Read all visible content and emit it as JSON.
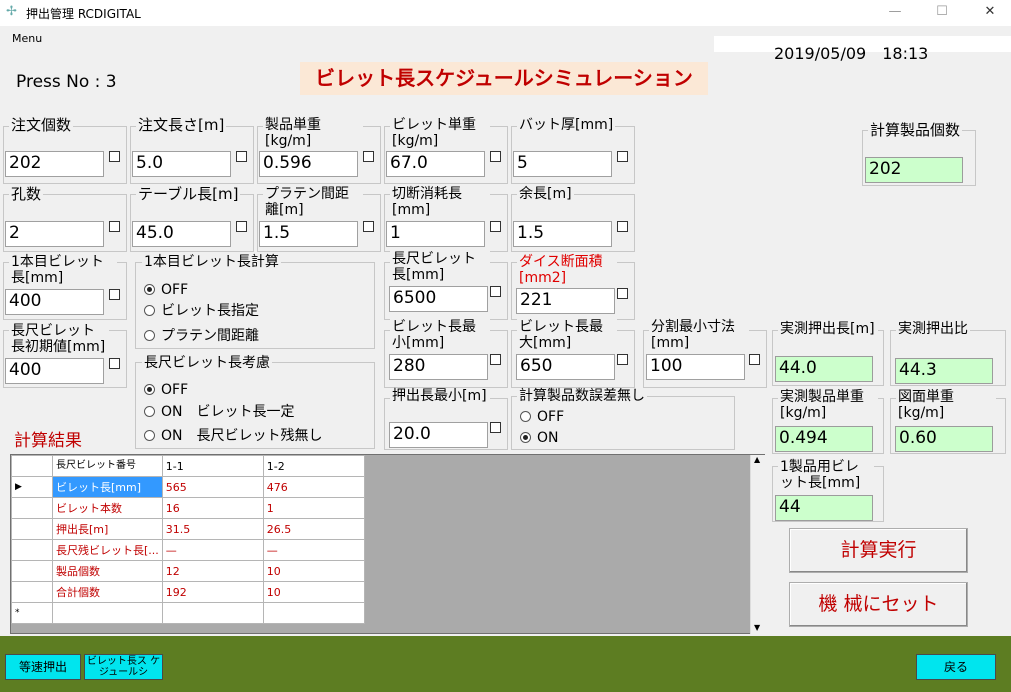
{
  "window": {
    "app_icon": "snowflake-icon",
    "title": "押出管理 RCDIGITAL",
    "minimize": "—",
    "maximize": "☐",
    "close": "✕"
  },
  "menu": {
    "label": "Menu"
  },
  "datetime": "2019/05/09　18:13",
  "press_no": "Press No : 3",
  "banner": "ビレット長スケジュールシミュレーション",
  "fields": {
    "order_count": {
      "label": "注文個数",
      "value": "202"
    },
    "order_length": {
      "label": "注文長さ[m]",
      "value": "5.0"
    },
    "product_unit_weight": {
      "label": "製品単重[kg/m]",
      "value": "0.596"
    },
    "billet_unit_weight": {
      "label": "ビレット単重[kg/m]",
      "value": "67.0"
    },
    "butt_thickness": {
      "label": "バット厚[mm]",
      "value": "5"
    },
    "holes": {
      "label": "孔数",
      "value": "2"
    },
    "table_length": {
      "label": "テーブル長[m]",
      "value": "45.0"
    },
    "platen_distance": {
      "label": "プラテン間距離[m]",
      "value": "1.5"
    },
    "cut_loss": {
      "label": "切断消耗長[mm]",
      "value": "1"
    },
    "remainder": {
      "label": "余長[m]",
      "value": "1.5"
    },
    "first_billet_length": {
      "label": "1本目ビレット長[mm]",
      "value": "400"
    },
    "long_billet_length": {
      "label": "長尺ビレット長[mm]",
      "value": "6500"
    },
    "die_area": {
      "label": "ダイス断面積[mm2]",
      "value": "221"
    },
    "long_billet_initial": {
      "label": "長尺ビレット長初期値[mm]",
      "value": "400"
    },
    "billet_min": {
      "label": "ビレット長最小[mm]",
      "value": "280"
    },
    "billet_max": {
      "label": "ビレット長最大[mm]",
      "value": "650"
    },
    "split_min": {
      "label": "分割最小寸法[mm]",
      "value": "100"
    },
    "extrusion_min": {
      "label": "押出長最小[m]",
      "value": "20.0"
    }
  },
  "first_billet_calc": {
    "title": "1本目ビレット長計算",
    "options": [
      "OFF",
      "ビレット長指定",
      "プラテン間距離"
    ],
    "selected": 0
  },
  "long_billet_consider": {
    "title": "長尺ビレット長考慮",
    "options": [
      "OFF",
      "ON　ビレット長一定",
      "ON　長尺ビレット残無し"
    ],
    "selected": 0
  },
  "calc_error_none": {
    "title": "計算製品数誤差無し",
    "options": [
      "OFF",
      "ON"
    ],
    "selected": 1
  },
  "results_side": {
    "calc_product_count": {
      "label": "計算製品個数",
      "value": "202"
    },
    "measured_length": {
      "label": "実測押出長[m]",
      "value": "44.0"
    },
    "measured_ratio": {
      "label": "実測押出比",
      "value": "44.3"
    },
    "measured_unit_weight": {
      "label": "実測製品単重[kg/m]",
      "value": "0.494"
    },
    "drawing_unit_weight": {
      "label": "図面単重[kg/m]",
      "value": "0.60"
    },
    "billet_per_product": {
      "label": "1製品用ビレット長[mm]",
      "value": "44"
    }
  },
  "result_title": "計算結果",
  "table": {
    "header_label": "長尺ビレット番号",
    "columns": [
      "1-1",
      "1-2"
    ],
    "rows": [
      {
        "label": "ビレット長[mm]",
        "values": [
          "565",
          "476"
        ]
      },
      {
        "label": "ビレット本数",
        "values": [
          "16",
          "1"
        ]
      },
      {
        "label": "押出長[m]",
        "values": [
          "31.5",
          "26.5"
        ]
      },
      {
        "label": "長尺残ビレット長[...",
        "values": [
          "—",
          "—"
        ]
      },
      {
        "label": "製品個数",
        "values": [
          "12",
          "10"
        ]
      },
      {
        "label": "合計個数",
        "values": [
          "192",
          "10"
        ]
      }
    ],
    "row_marker": "▶",
    "new_row_marker": "*"
  },
  "buttons": {
    "calculate": "計算実行",
    "set_machine": "機 械にセット",
    "constant_speed": "等速押出",
    "billet_schedule": "ビレット長ス ケジュールシ",
    "back": "戻る"
  }
}
